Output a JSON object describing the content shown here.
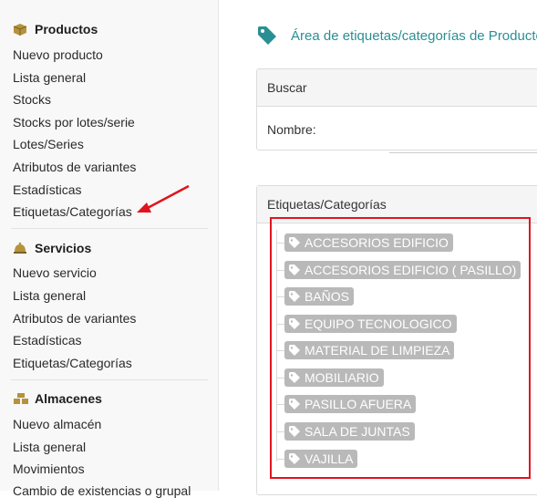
{
  "sidebar": {
    "sections": [
      {
        "title": "Productos",
        "icon": "box-icon",
        "items": [
          "Nuevo producto",
          "Lista general",
          "Stocks",
          "Stocks por lotes/serie",
          "Lotes/Series",
          "Atributos de variantes",
          "Estadísticas",
          "Etiquetas/Categorías"
        ]
      },
      {
        "title": "Servicios",
        "icon": "bell-icon",
        "items": [
          "Nuevo servicio",
          "Lista general",
          "Atributos de variantes",
          "Estadísticas",
          "Etiquetas/Categorías"
        ]
      },
      {
        "title": "Almacenes",
        "icon": "boxes-icon",
        "items": [
          "Nuevo almacén",
          "Lista general",
          "Movimientos",
          "Cambio de existencias o grupal"
        ]
      }
    ]
  },
  "main": {
    "title": "Área de etiquetas/categorías de Productos",
    "search_panel": {
      "header": "Buscar",
      "name_label": "Nombre:",
      "name_value": ""
    },
    "categories_panel": {
      "header": "Etiquetas/Categorías",
      "tags": [
        "ACCESORIOS EDIFICIO",
        "ACCESORIOS EDIFICIO ( PASILLO)",
        "BAÑOS",
        "EQUIPO TECNOLOGICO",
        "MATERIAL DE LIMPIEZA",
        "MOBILIARIO",
        "PASILLO AFUERA",
        "SALA DE JUNTAS",
        "VAJILLA"
      ]
    }
  },
  "colors": {
    "accent": "#2a8f94",
    "tag_bg": "#b9b9b9",
    "highlight": "#e0141e"
  }
}
